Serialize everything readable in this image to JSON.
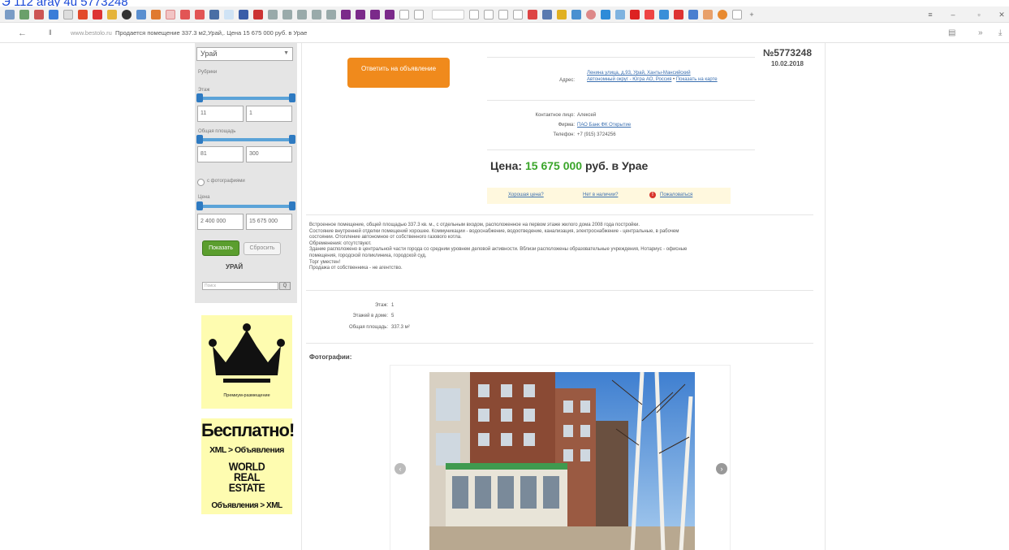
{
  "top_link": "Э 112 aray 4u 5773248",
  "address_bar": {
    "domain": "www.bestolo.ru",
    "title": "Продается помещение 337.3 м2,Урай,. Цена 15 675 000 руб. в Урае"
  },
  "sidebar": {
    "city_select": "Урай",
    "rubric_label": "Рубрики",
    "floor_label": "Этаж",
    "floor_from": "11",
    "floor_to": "1",
    "area_label": "Общая площадь",
    "area_from": "81",
    "area_to": "300",
    "photo_checkbox_label": "с фотографиями",
    "price_label": "Цена",
    "price_from": "2 400 000",
    "price_to": "15 675 000",
    "show_button": "Показать",
    "reset_button": "Сбросить",
    "city_name": "УРАЙ",
    "search_placeholder": "Поиск",
    "search_button": "Q"
  },
  "banner1": {
    "caption": "Премиум-размещение"
  },
  "banner2": {
    "line1": "Бесплатно!",
    "line2": "XML > Объявления",
    "logo1": "WORLD",
    "logo2": "REAL",
    "logo3": "ESTATE",
    "line3": "Объявления > XML"
  },
  "ad": {
    "number": "№5773248",
    "date": "10.02.2018",
    "reply_button": "Ответить на объявление",
    "address_label": "Адрес:",
    "address_line1": "Ленина улица, д.93, Урай, Ханты-Мансийский",
    "address_line2": "Автономный округ - Югра АО, Россия",
    "address_map_link": "Показать на карте",
    "contact_label": "Контактное лицо:",
    "contact_value": "Алексей",
    "company_label": "Фирма:",
    "company_value": "ПАО Банк ФК Открытие",
    "phone_label": "Телефон:",
    "phone_value": "+7 (915) 3724256",
    "price_prefix": "Цена:",
    "price_amount": "15 675 000",
    "price_suffix": "руб. в Урае",
    "action1": "Хорошая цена?",
    "action2": "Нет в наличии?",
    "action3": "Пожаловаться",
    "description": [
      "Встроенное помещение, общей площадью 337.3 кв. м., с отдельным входом, расположенное на первом этаже жилого дома 2008 года постройки.",
      "Состояние внутренней отделки помещений хорошее. Коммуникации - водоснабжение, водоотведение, канализация, электроснабжение - центральные, в рабочем",
      "состоянии. Отопление автономное от собственного газового котла.",
      "Обременения: отсутствуют.",
      "Здание расположено в центральной части города со средним уровнем деловой активности. Вблизи расположены образовательные учреждения, Нотариус - офисные",
      "помещения, городской поликлиника, городской суд.",
      "Торг уместен!",
      "Продажа от собственника - не агентство."
    ],
    "params": [
      {
        "label": "Этаж:",
        "value": "1"
      },
      {
        "label": "Этажей в доме:",
        "value": "5"
      },
      {
        "label": "Общая площадь:",
        "value": "337.3 м²"
      }
    ],
    "photos_heading": "Фотографии:"
  },
  "colors": {
    "accent_orange": "#f08a1c",
    "price_green": "#3aa52a",
    "show_green": "#5b9e2e",
    "slider_blue": "#2e7ac1",
    "banner_yellow": "#fefcb0"
  },
  "icons": {
    "back": "arrow-left-icon",
    "prev_photo": "chevron-left-icon",
    "next_photo": "chevron-right-icon"
  }
}
